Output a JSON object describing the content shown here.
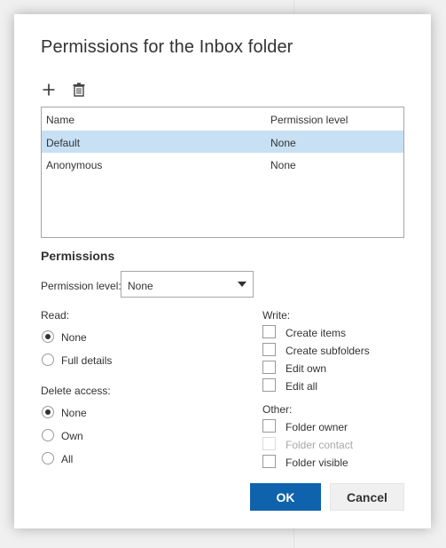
{
  "dialog": {
    "title": "Permissions for the Inbox folder",
    "toolbar": {
      "add_icon": "plus-icon",
      "delete_icon": "trash-icon"
    },
    "table": {
      "headers": [
        "Name",
        "Permission level"
      ],
      "rows": [
        {
          "name": "Default",
          "level": "None",
          "selected": true
        },
        {
          "name": "Anonymous",
          "level": "None",
          "selected": false
        }
      ]
    },
    "permissions": {
      "title": "Permissions",
      "level_label": "Permission level:",
      "level_value": "None",
      "read": {
        "label": "Read:",
        "options": [
          {
            "label": "None",
            "checked": true
          },
          {
            "label": "Full details",
            "checked": false
          }
        ]
      },
      "delete": {
        "label": "Delete access:",
        "options": [
          {
            "label": "None",
            "checked": true
          },
          {
            "label": "Own",
            "checked": false
          },
          {
            "label": "All",
            "checked": false
          }
        ]
      },
      "write": {
        "label": "Write:",
        "options": [
          {
            "label": "Create items",
            "checked": false
          },
          {
            "label": "Create subfolders",
            "checked": false
          },
          {
            "label": "Edit own",
            "checked": false
          },
          {
            "label": "Edit all",
            "checked": false
          }
        ]
      },
      "other": {
        "label": "Other:",
        "options": [
          {
            "label": "Folder owner",
            "checked": false,
            "disabled": false
          },
          {
            "label": "Folder contact",
            "checked": false,
            "disabled": true
          },
          {
            "label": "Folder visible",
            "checked": false,
            "disabled": false
          }
        ]
      }
    },
    "buttons": {
      "ok": "OK",
      "cancel": "Cancel"
    },
    "colors": {
      "accent": "#0f63ad",
      "selected_row": "#c7e0f4"
    }
  }
}
